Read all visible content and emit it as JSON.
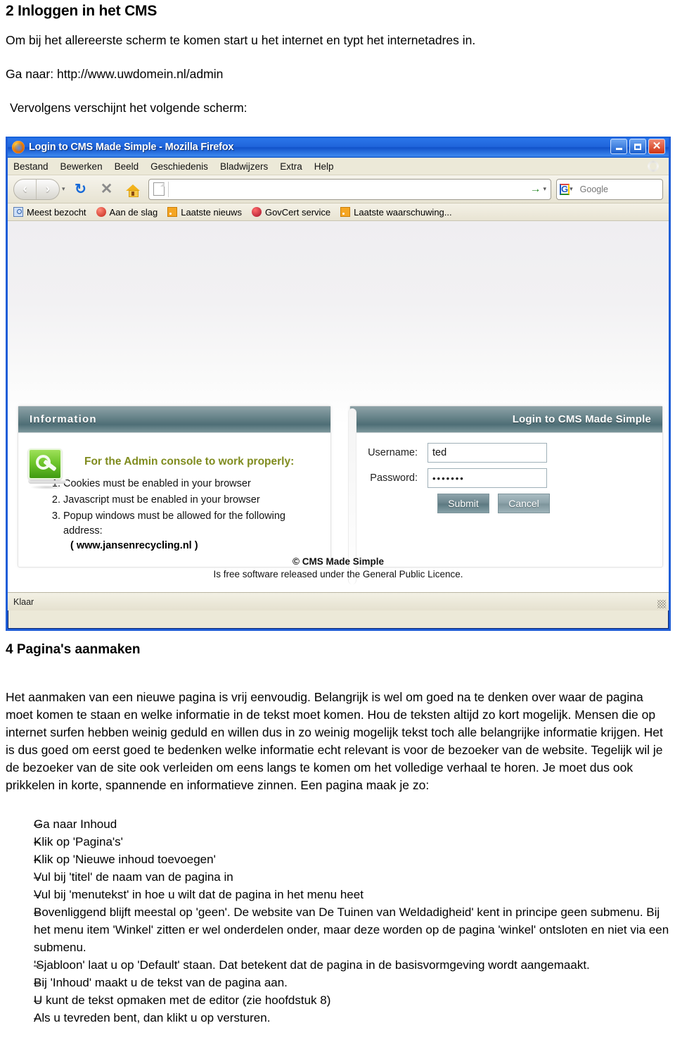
{
  "document": {
    "heading1": "2 Inloggen in het CMS",
    "intro_line_1": "Om bij het allereerste scherm te komen start u het internet en typt het internetadres in.",
    "intro_line_2": "Ga naar: http://www.uwdomein.nl/admin",
    "intro_line_3": "Vervolgens verschijnt het volgende scherm:",
    "heading2": "4 Pagina's aanmaken",
    "body_paragraph": "Het aanmaken van een nieuwe pagina is vrij eenvoudig. Belangrijk is wel om goed na te denken over waar de pagina moet komen te staan en welke informatie in de tekst moet komen. Hou de teksten altijd zo kort mogelijk. Mensen die op internet surfen hebben weinig geduld en willen dus in zo weinig mogelijk tekst toch alle belangrijke informatie krijgen. Het is dus goed om eerst goed te bedenken welke informatie echt relevant is voor de bezoeker van de website. Tegelijk wil je de bezoeker van de site ook verleiden om eens langs te komen om het volledige verhaal te horen. Je moet dus ook prikkelen in korte, spannende en informatieve zinnen. Een pagina maak je zo:",
    "bullet_marker": "–",
    "bullets": [
      "Ga naar Inhoud",
      "Klik op 'Pagina's'",
      "Klik op 'Nieuwe inhoud toevoegen'",
      "Vul bij 'titel' de naam van de pagina in",
      "Vul bij 'menutekst' in hoe u wilt dat de pagina in het menu heet",
      "Bovenliggend blijft meestal op 'geen'. De website van De Tuinen van Weldadigheid' kent in principe geen submenu. Bij het menu item 'Winkel' zitten er wel onderdelen onder, maar deze worden op de pagina 'winkel' ontsloten en niet via een submenu.",
      "'Sjabloon' laat u op 'Default' staan. Dat betekent dat de pagina in de basisvormgeving wordt aangemaakt.",
      "Bij 'Inhoud' maakt u de tekst van de pagina aan.",
      "U kunt de tekst opmaken met de editor (zie hoofdstuk 8)",
      "Als u tevreden bent, dan klikt u op versturen."
    ]
  },
  "browser": {
    "title": "Login to CMS Made Simple - Mozilla Firefox",
    "window_buttons": {
      "minimize": "_",
      "maximize": "□",
      "close": "✕"
    },
    "menu": [
      "Bestand",
      "Bewerken",
      "Beeld",
      "Geschiedenis",
      "Bladwijzers",
      "Extra",
      "Help"
    ],
    "toolbar": {
      "back": "‹",
      "forward": "›",
      "history_caret": "▾",
      "reload": "↻",
      "stop": "✕",
      "home": "home-icon",
      "url_value": "",
      "url_placeholder": "",
      "go": "→",
      "go_caret": "▾",
      "search_engine": "G",
      "search_caret": "▾",
      "search_placeholder": "Google"
    },
    "bookmarks": [
      {
        "label": "Meest bezocht",
        "icon": "most-visited-icon"
      },
      {
        "label": "Aan de slag",
        "icon": "get-started-icon"
      },
      {
        "label": "Laatste nieuws",
        "icon": "rss-icon"
      },
      {
        "label": "GovCert service",
        "icon": "govcert-icon"
      },
      {
        "label": "Laatste waarschuwing...",
        "icon": "rss-icon"
      }
    ],
    "status": "Klaar"
  },
  "cms": {
    "info_panel": {
      "header": "Information",
      "icon": "wrench-screen-icon",
      "title": "For the Admin console to work properly:",
      "requirements": [
        "Cookies must be enabled in your browser",
        "Javascript must be enabled in your browser",
        "Popup windows must be allowed for the following address:"
      ],
      "address": "( www.jansenrecycling.nl )"
    },
    "login_panel": {
      "header": "Login to CMS Made Simple",
      "username_label": "Username:",
      "username_value": "ted",
      "password_label": "Password:",
      "password_value": "•••••••",
      "submit_label": "Submit",
      "cancel_label": "Cancel"
    },
    "footer_line_1": "© CMS Made Simple",
    "footer_line_2": "Is free software released under the General Public Licence."
  },
  "colors": {
    "titlebar_blue": "#1f65db",
    "window_border": "#1f5ed8",
    "panel_header": "#4e6e76",
    "info_title_olive": "#7f8b1e",
    "chrome_beige": "#ece9d8"
  }
}
